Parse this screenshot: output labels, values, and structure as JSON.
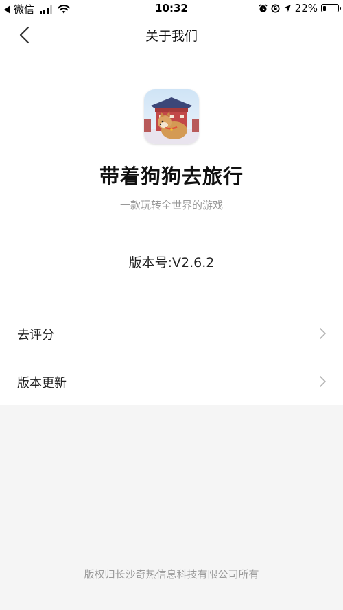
{
  "status_bar": {
    "carrier": "微信",
    "time": "10:32",
    "battery_text": "22%",
    "battery_level": 0.22
  },
  "nav": {
    "title": "关于我们"
  },
  "app": {
    "name": "带着狗狗去旅行",
    "slogan": "一款玩转全世界的游戏",
    "version": "版本号:V2.6.2"
  },
  "menu": {
    "items": [
      {
        "label": "去评分"
      },
      {
        "label": "版本更新"
      }
    ]
  },
  "footer": {
    "copyright": "版权归长沙奇热信息科技有限公司所有"
  },
  "colors": {
    "background": "#f5f5f5",
    "card": "#ffffff",
    "secondary_text": "#999999",
    "divider": "#eeeeee"
  }
}
